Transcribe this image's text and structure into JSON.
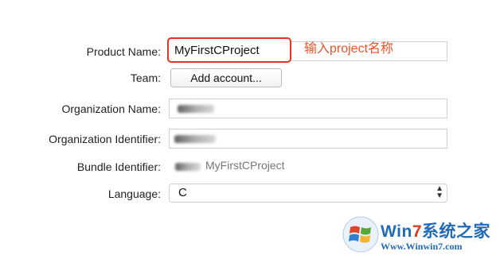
{
  "form": {
    "product_name_label": "Product Name:",
    "product_name_value": "MyFirstCProject",
    "team_label": "Team:",
    "add_account_button": "Add account...",
    "organization_name_label": "Organization Name:",
    "organization_identifier_label": "Organization Identifier:",
    "bundle_identifier_label": "Bundle Identifier:",
    "bundle_identifier_value": "MyFirstCProject",
    "language_label": "Language:",
    "language_value": "C"
  },
  "annotation": "输入project名称",
  "watermark": {
    "brand_prefix": "Win",
    "brand_seven": "7",
    "brand_suffix": "系统之家",
    "url": "Www.Winwin7.com"
  },
  "colors": {
    "highlight": "#e63422",
    "annotation": "#e5542b"
  }
}
